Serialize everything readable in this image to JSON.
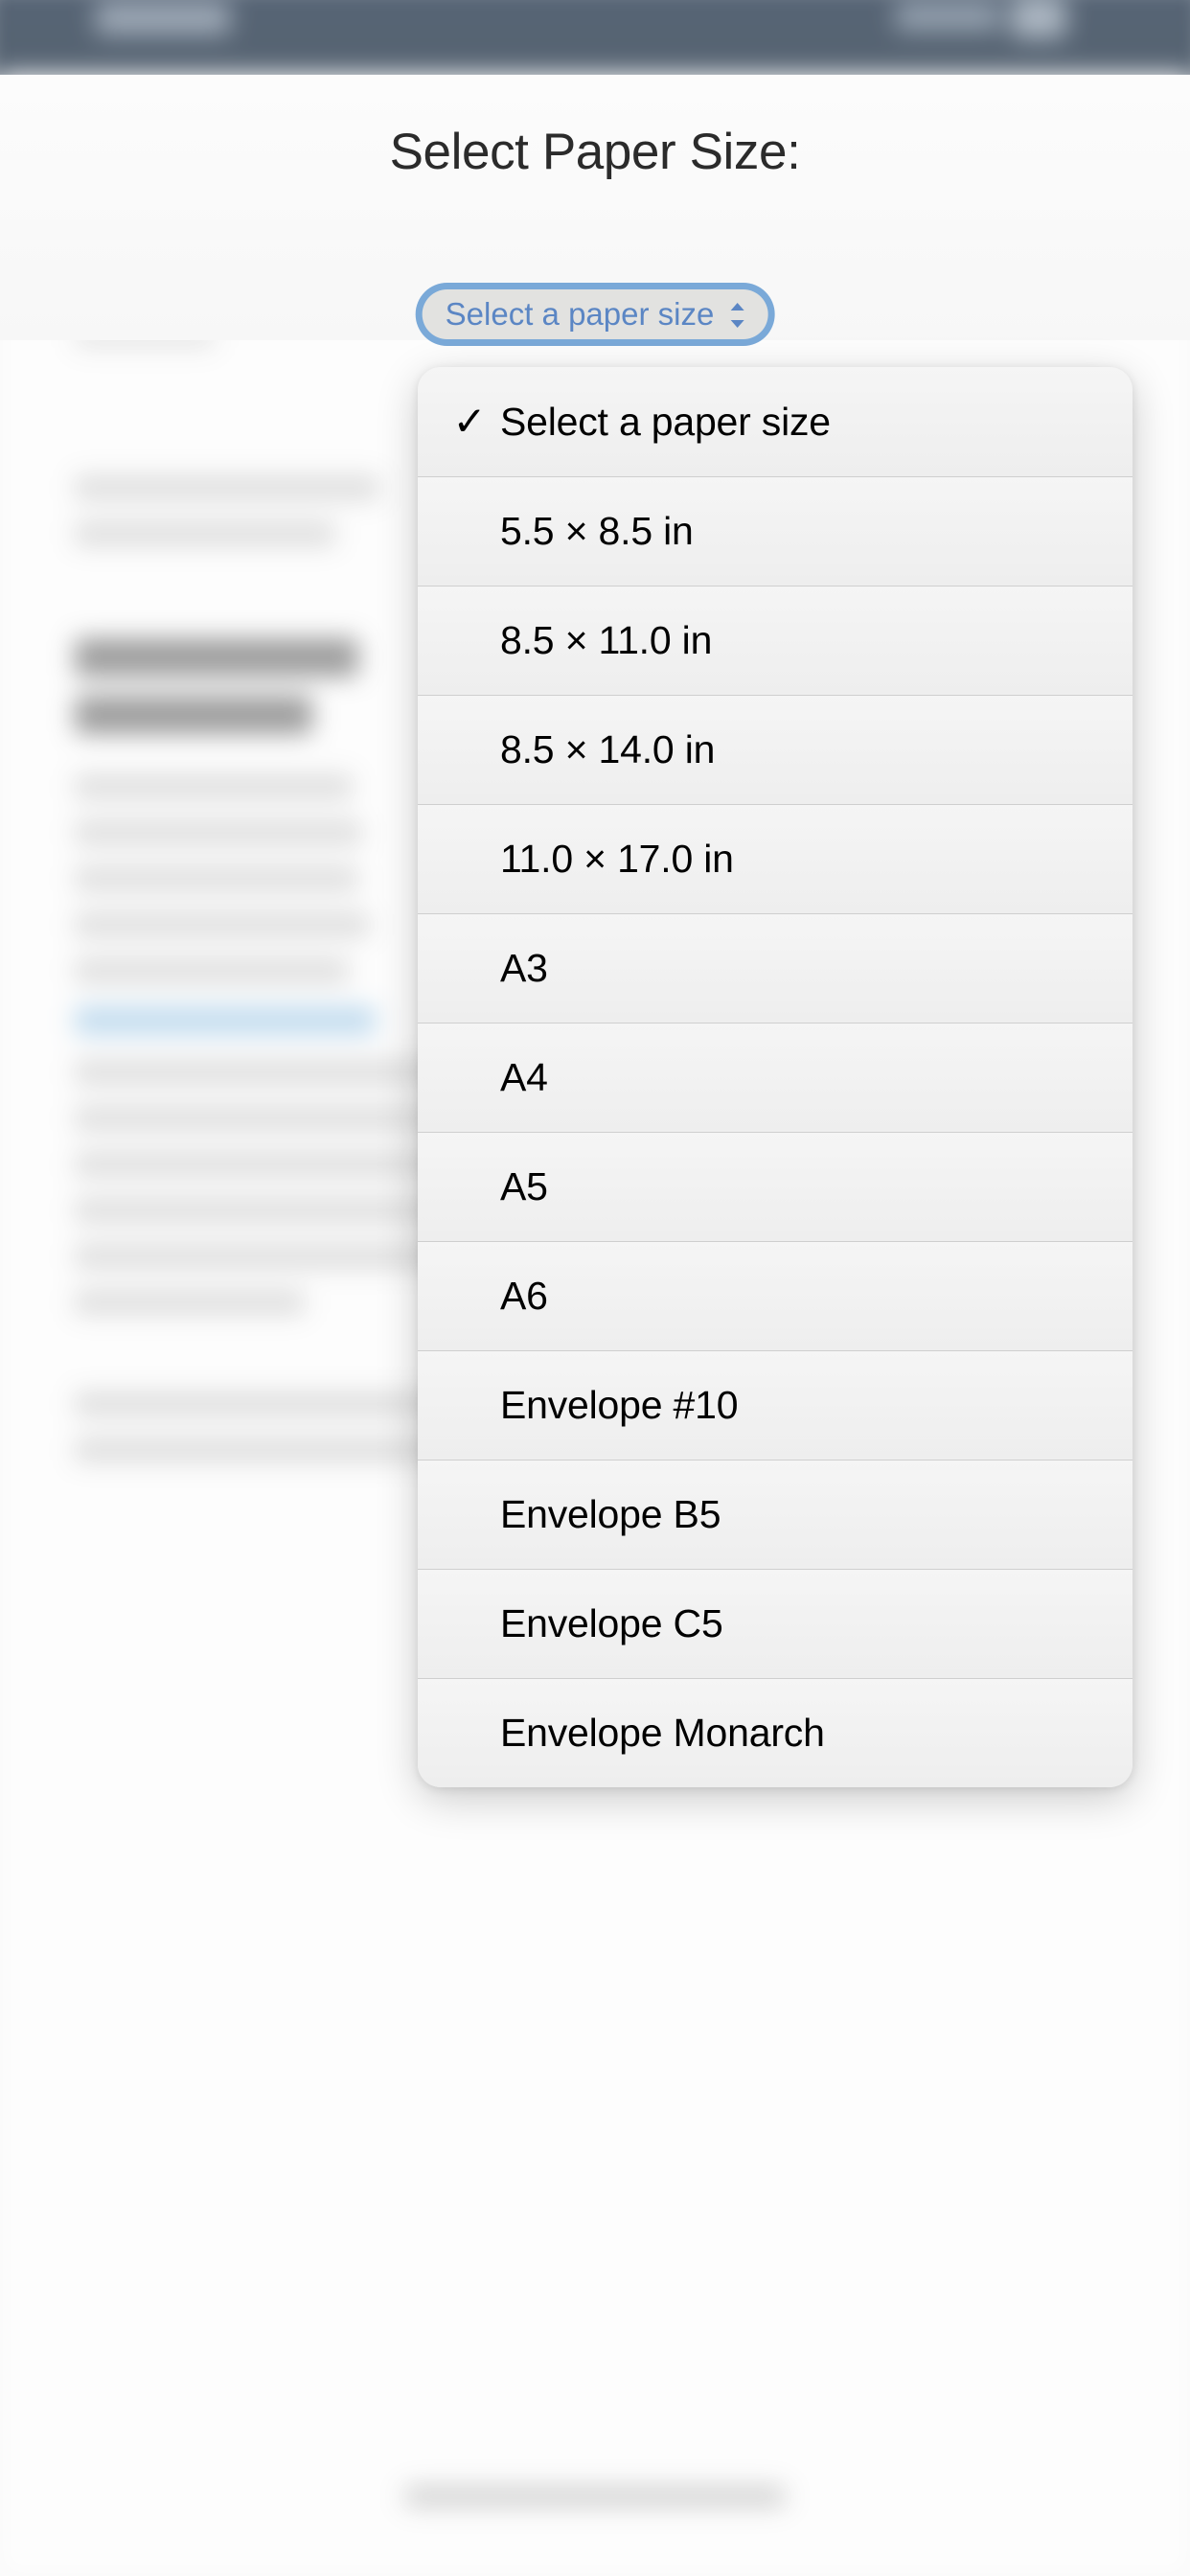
{
  "statusbar": {
    "style": "dark-navy",
    "color": "#12263f"
  },
  "navbar": {
    "background_color": "#12263f",
    "title_obscured": true,
    "right_actions_obscured": true
  },
  "form": {
    "heading": "Select Paper Size:",
    "select": {
      "value": "Select a paper size",
      "placeholder": "Select a paper size",
      "focused": true,
      "focus_ring_color": "#7aa9d8",
      "text_color": "#5b86c4",
      "background_color": "#e2e2e0",
      "caret_icon": "chevron-up-down-icon"
    }
  },
  "dropdown": {
    "open": true,
    "selected_index": 0,
    "check_glyph": "✓",
    "background_color": "#f3f3f3",
    "items": [
      {
        "label": "Select a paper size",
        "selected": true
      },
      {
        "label": "5.5 × 8.5 in",
        "selected": false
      },
      {
        "label": "8.5 × 11.0 in",
        "selected": false
      },
      {
        "label": "8.5 × 14.0 in",
        "selected": false
      },
      {
        "label": "11.0 × 17.0 in",
        "selected": false
      },
      {
        "label": "A3",
        "selected": false
      },
      {
        "label": "A4",
        "selected": false
      },
      {
        "label": "A5",
        "selected": false
      },
      {
        "label": "A6",
        "selected": false
      },
      {
        "label": "Envelope #10",
        "selected": false
      },
      {
        "label": "Envelope B5",
        "selected": false
      },
      {
        "label": "Envelope C5",
        "selected": false
      },
      {
        "label": "Envelope Monarch",
        "selected": false
      }
    ]
  },
  "background_page": {
    "blurred": true,
    "note": "page content behind the picker is blurred and unreadable",
    "link_color": "#a7cdea",
    "home_indicator_visible": true
  }
}
